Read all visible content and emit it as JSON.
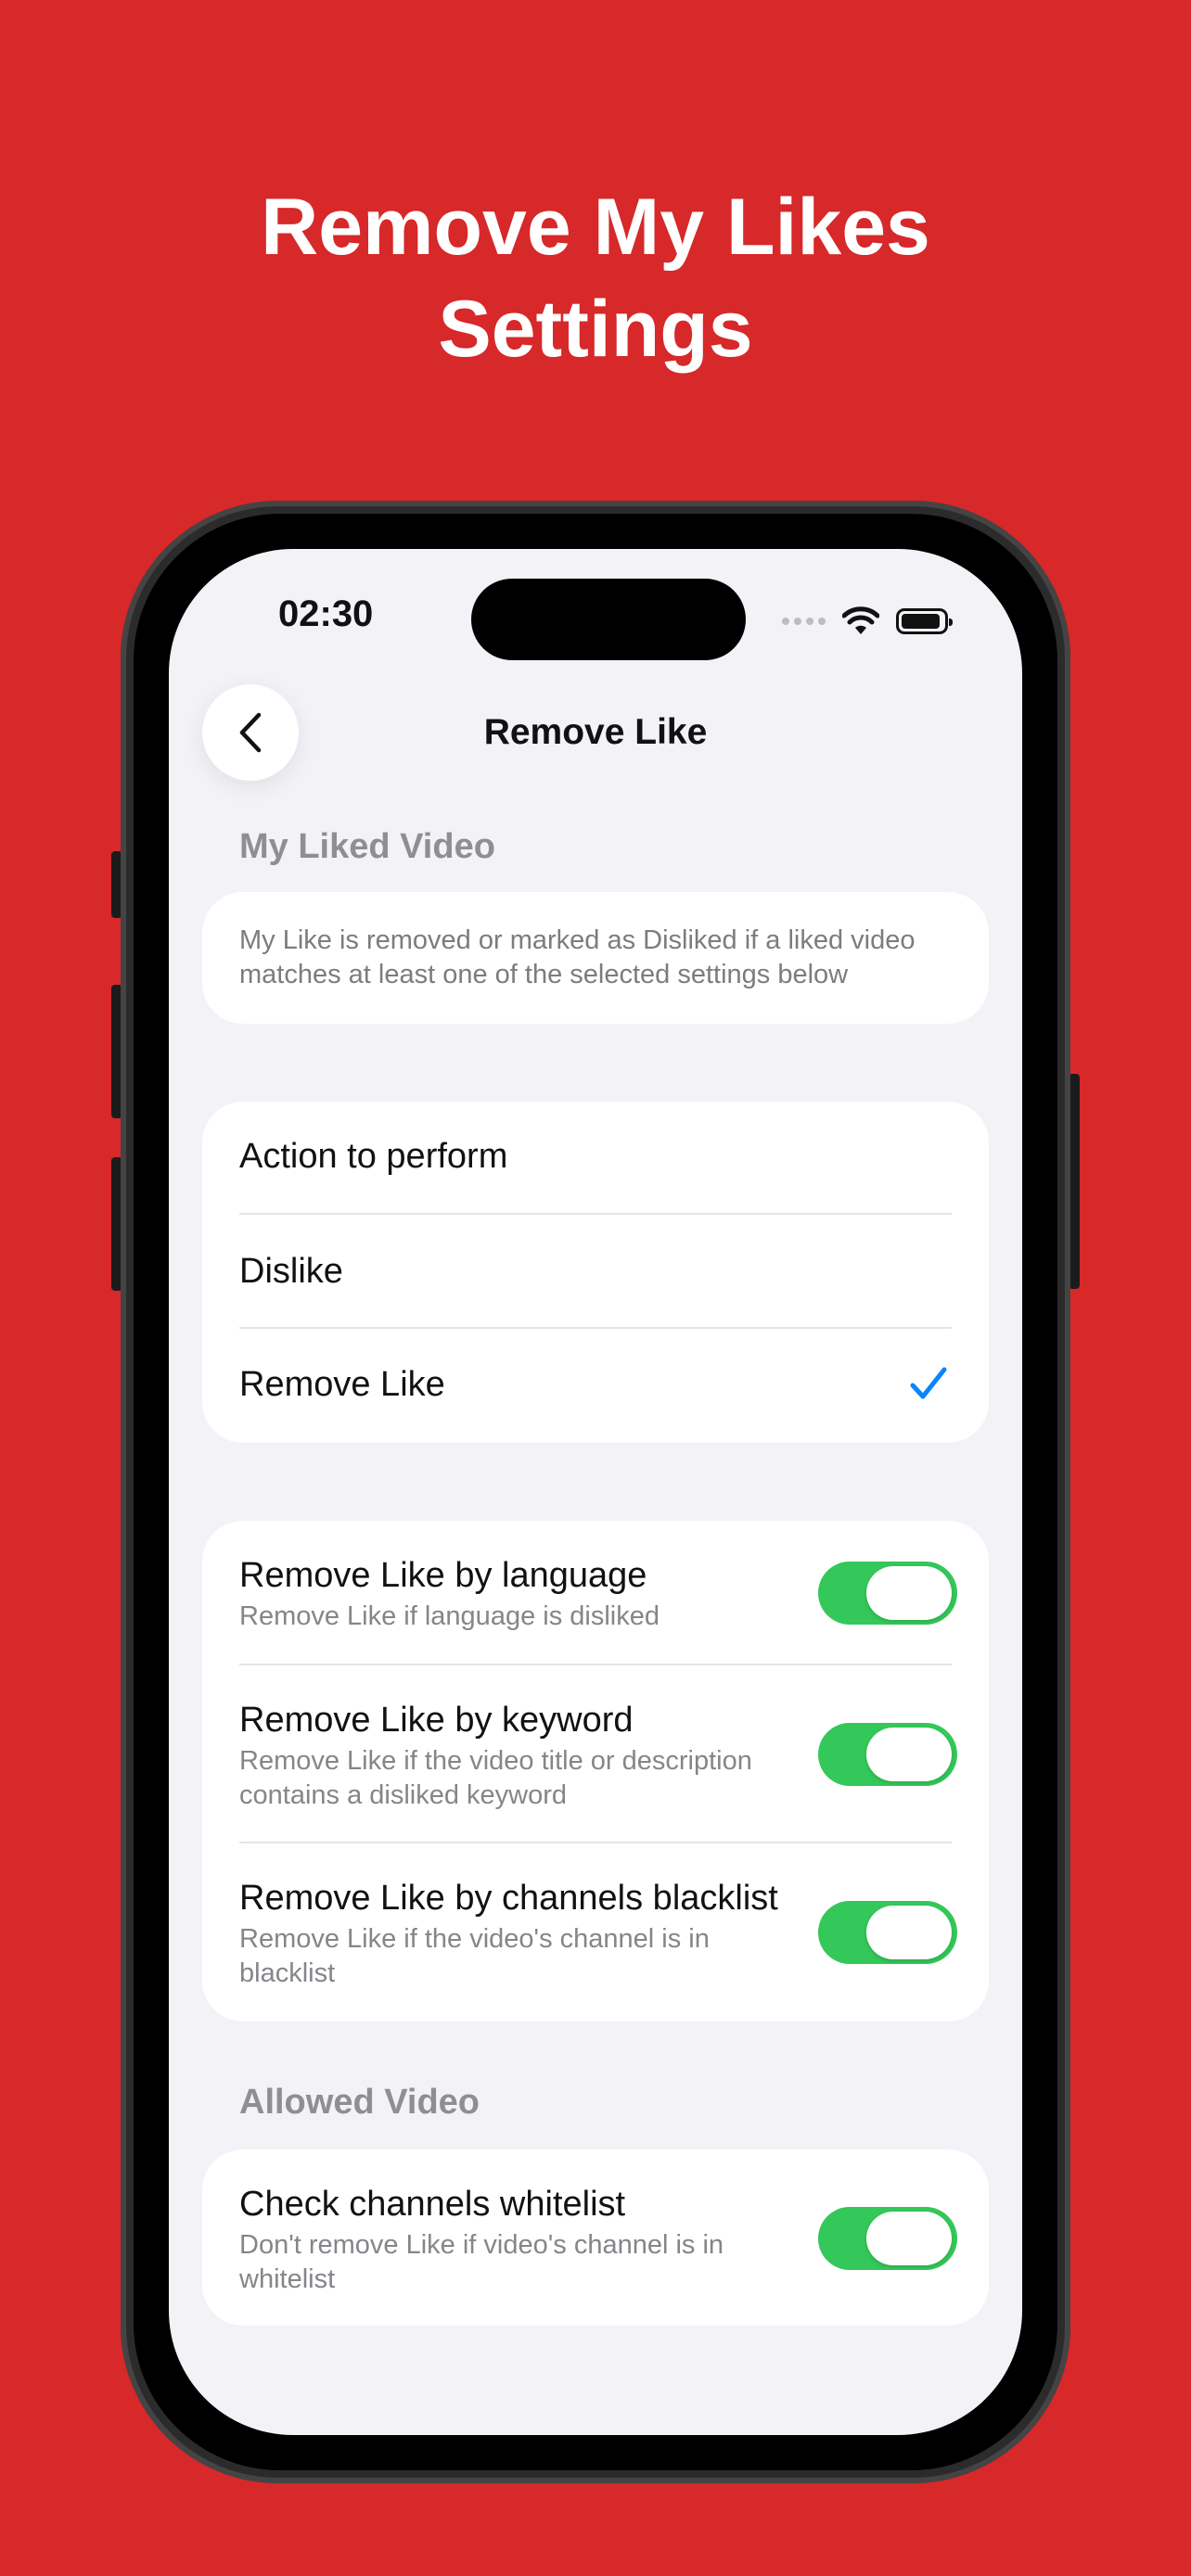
{
  "headline": {
    "line1": "Remove My Likes",
    "line2": "Settings"
  },
  "status_bar": {
    "time": "02:30"
  },
  "nav": {
    "title": "Remove Like"
  },
  "sections": {
    "my_liked_video": {
      "header": "My Liked Video",
      "info": "My Like is removed or marked as Disliked if a liked video matches at least one of the selected settings below"
    },
    "action": {
      "title": "Action to perform",
      "options": [
        {
          "label": "Dislike",
          "selected": false
        },
        {
          "label": "Remove Like",
          "selected": true
        }
      ]
    },
    "rules": [
      {
        "title": "Remove Like by language",
        "subtitle": "Remove Like if language is disliked",
        "enabled": true
      },
      {
        "title": "Remove Like by keyword",
        "subtitle": "Remove Like if the video title or description contains a disliked keyword",
        "enabled": true
      },
      {
        "title": "Remove Like by channels blacklist",
        "subtitle": "Remove Like if the video's channel is in blacklist",
        "enabled": true
      }
    ],
    "allowed_video": {
      "header": "Allowed Video",
      "items": [
        {
          "title": "Check channels whitelist",
          "subtitle": "Don't remove Like if video's channel is in whitelist",
          "enabled": true
        }
      ]
    }
  },
  "colors": {
    "background": "#d7282a",
    "toggle_on": "#34c759",
    "accent": "#0a84ff"
  }
}
